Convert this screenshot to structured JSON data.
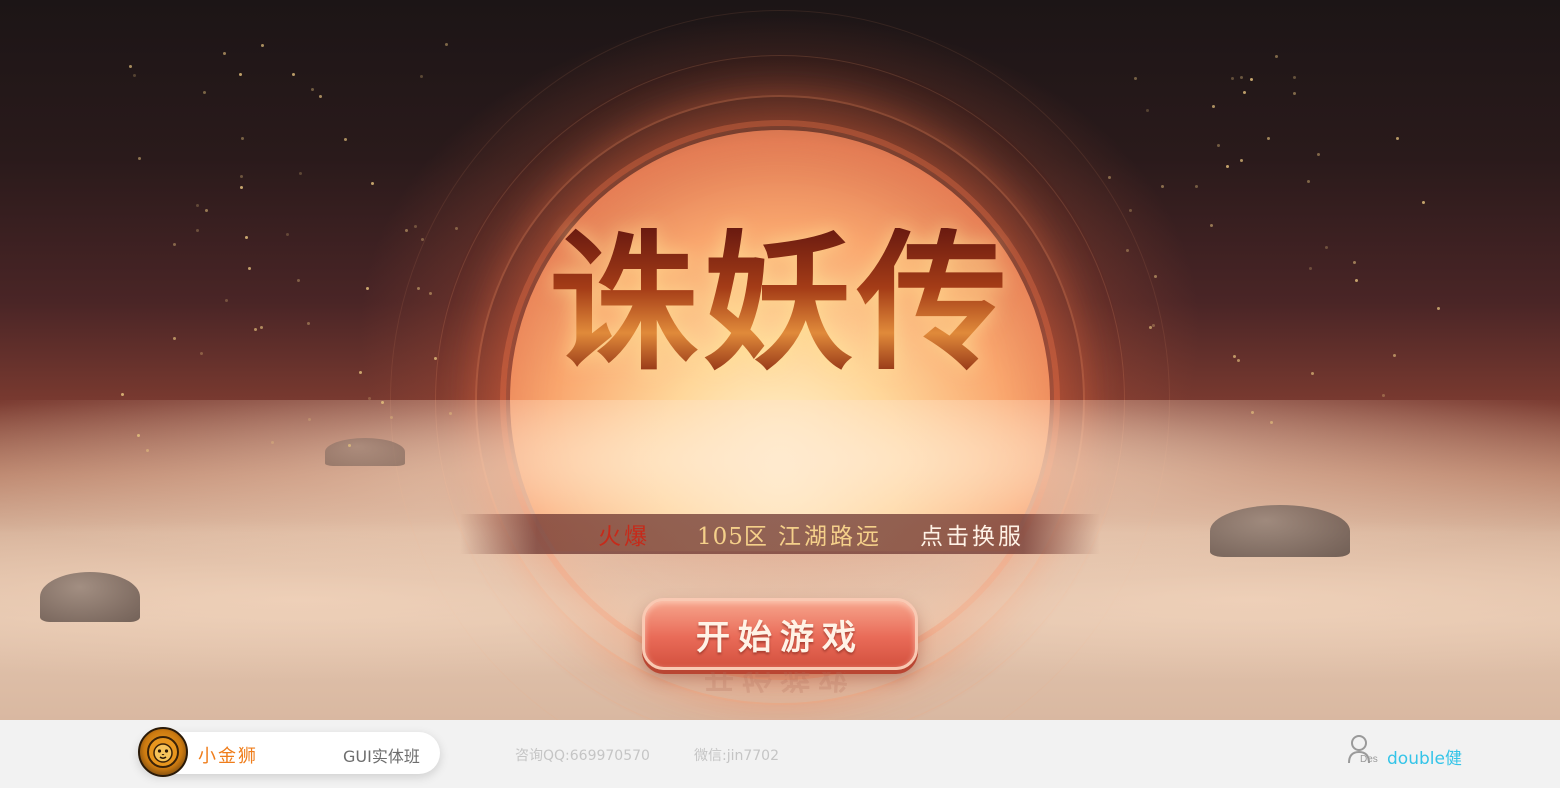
{
  "game": {
    "logo_text": "诛妖传",
    "server": {
      "status": "火爆",
      "zone": "105区",
      "zone_name": "江湖路远",
      "switch_label": "点击换服"
    },
    "start_button_label": "开始游戏"
  },
  "footer": {
    "brand_name": "小金狮",
    "course": "GUI实体班",
    "qq": "咨询QQ:669970570",
    "wechat": "微信:jin7702",
    "user_icon_label": "Des",
    "user_name": "double健"
  },
  "colors": {
    "status_hot": "#c62a1a",
    "zone_gold": "#f5d08a",
    "button_coral": "#e96b58",
    "brand_orange": "#ef7d1b",
    "user_cyan": "#34c4e8"
  },
  "icons": {
    "brand": "lion-head-icon",
    "user": "user-outline-icon"
  }
}
